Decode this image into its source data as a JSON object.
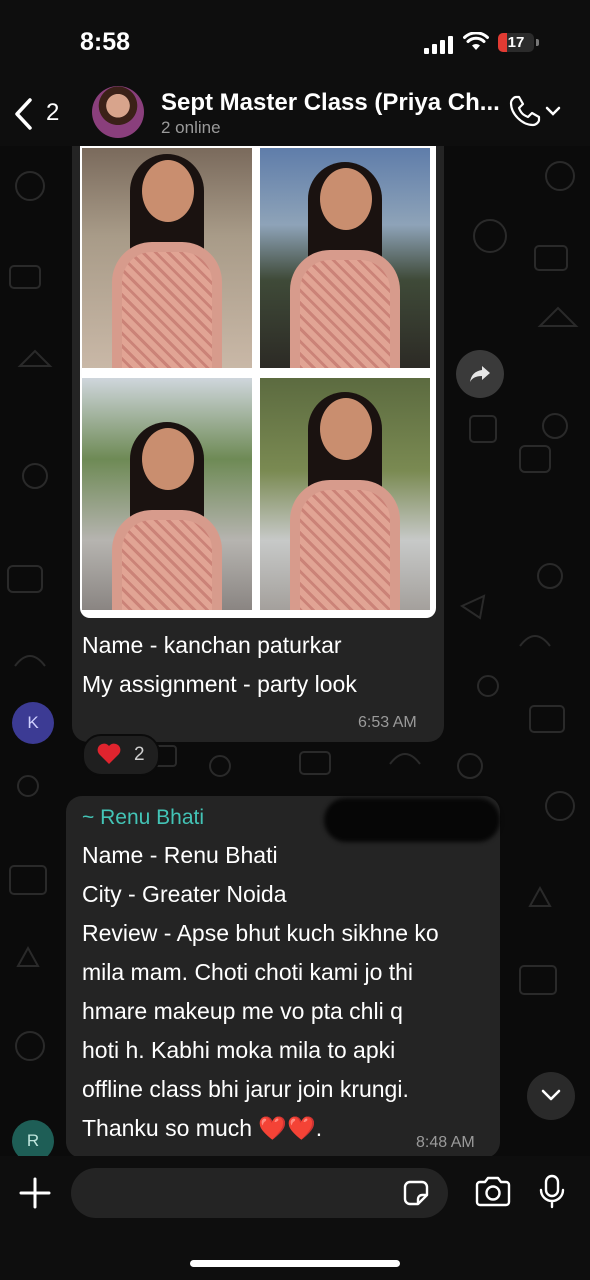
{
  "status_bar": {
    "time": "8:58",
    "battery_level": "17",
    "battery_fraction": 0.17
  },
  "header": {
    "back_count": "2",
    "group_name": "Sept Master Class (Priya Ch...",
    "subtitle": "2 online"
  },
  "messages": [
    {
      "type": "image_album",
      "photo_count": 4,
      "lines": [
        "Name - kanchan paturkar",
        "My assignment - party look"
      ],
      "time": "6:53 AM",
      "avatar_letter": "K",
      "reaction": {
        "emoji": "❤️",
        "count": "2"
      }
    },
    {
      "type": "text",
      "sender": "~ Renu Bhati",
      "lines": [
        "Name - Renu Bhati",
        "City - Greater Noida",
        "Review - Apse bhut kuch sikhne ko",
        "mila mam. Choti choti kami jo thi",
        "hmare makeup me vo pta chli q",
        "hoti h. Kabhi moka mila to apki",
        "offline class bhi jarur join krungi.",
        "Thanku so much"
      ],
      "last_line_emoji": "❤️❤️.",
      "time": "8:48 AM",
      "avatar_letter": "R"
    }
  ],
  "colors": {
    "sender_name": "#43c4b6",
    "bubble": "#242424",
    "background": "#0b0b0b",
    "battery": "#e23b33"
  },
  "icons": [
    "back-chevron-icon",
    "phone-icon",
    "chevron-down-icon",
    "forward-icon",
    "heart-icon",
    "plus-icon",
    "sticker-icon",
    "camera-icon",
    "mic-icon"
  ]
}
